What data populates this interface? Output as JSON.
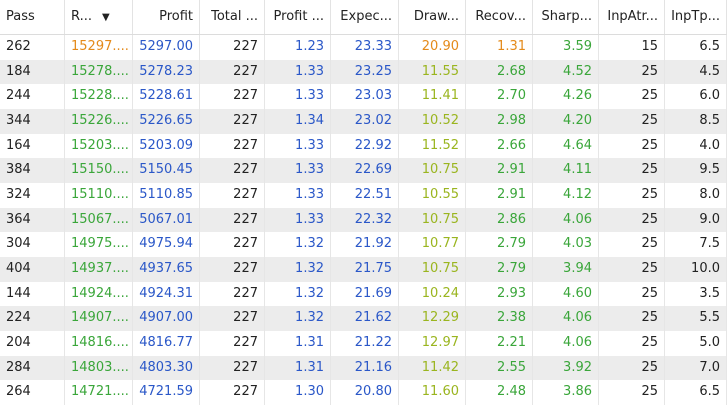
{
  "columns": [
    {
      "label": "Pass"
    },
    {
      "label": "R...",
      "sort_icon": "sort-desc-icon",
      "sort_glyph": "▼"
    },
    {
      "label": "Profit"
    },
    {
      "label": "Total ..."
    },
    {
      "label": "Profit ..."
    },
    {
      "label": "Expec..."
    },
    {
      "label": "Draw..."
    },
    {
      "label": "Recov..."
    },
    {
      "label": "Sharp..."
    },
    {
      "label": "InpAtr..."
    },
    {
      "label": "InpTp..."
    }
  ],
  "colors": {
    "black": "#222222",
    "green": "#3aa63a",
    "blue": "#2a57c8",
    "orange": "#e48a1a",
    "olive": "#9ab51f",
    "alt_row": "#ececec"
  },
  "rows": [
    {
      "pass": "262",
      "result": "15297....",
      "profit": "5297.00",
      "total": "227",
      "pf": "1.23",
      "exp": "23.33",
      "dd": "20.90",
      "rec": "1.31",
      "sharpe": "3.59",
      "atr": "15",
      "tp": "6.5",
      "style": "orange"
    },
    {
      "pass": "184",
      "result": "15278....",
      "profit": "5278.23",
      "total": "227",
      "pf": "1.33",
      "exp": "23.25",
      "dd": "11.55",
      "rec": "2.68",
      "sharpe": "4.52",
      "atr": "25",
      "tp": "4.5",
      "style": "green"
    },
    {
      "pass": "244",
      "result": "15228....",
      "profit": "5228.61",
      "total": "227",
      "pf": "1.33",
      "exp": "23.03",
      "dd": "11.41",
      "rec": "2.70",
      "sharpe": "4.26",
      "atr": "25",
      "tp": "6.0",
      "style": "green"
    },
    {
      "pass": "344",
      "result": "15226....",
      "profit": "5226.65",
      "total": "227",
      "pf": "1.34",
      "exp": "23.02",
      "dd": "10.52",
      "rec": "2.98",
      "sharpe": "4.20",
      "atr": "25",
      "tp": "8.5",
      "style": "green"
    },
    {
      "pass": "164",
      "result": "15203....",
      "profit": "5203.09",
      "total": "227",
      "pf": "1.33",
      "exp": "22.92",
      "dd": "11.52",
      "rec": "2.66",
      "sharpe": "4.64",
      "atr": "25",
      "tp": "4.0",
      "style": "green"
    },
    {
      "pass": "384",
      "result": "15150....",
      "profit": "5150.45",
      "total": "227",
      "pf": "1.33",
      "exp": "22.69",
      "dd": "10.75",
      "rec": "2.91",
      "sharpe": "4.11",
      "atr": "25",
      "tp": "9.5",
      "style": "green"
    },
    {
      "pass": "324",
      "result": "15110....",
      "profit": "5110.85",
      "total": "227",
      "pf": "1.33",
      "exp": "22.51",
      "dd": "10.55",
      "rec": "2.91",
      "sharpe": "4.12",
      "atr": "25",
      "tp": "8.0",
      "style": "green"
    },
    {
      "pass": "364",
      "result": "15067....",
      "profit": "5067.01",
      "total": "227",
      "pf": "1.33",
      "exp": "22.32",
      "dd": "10.75",
      "rec": "2.86",
      "sharpe": "4.06",
      "atr": "25",
      "tp": "9.0",
      "style": "green"
    },
    {
      "pass": "304",
      "result": "14975....",
      "profit": "4975.94",
      "total": "227",
      "pf": "1.32",
      "exp": "21.92",
      "dd": "10.77",
      "rec": "2.79",
      "sharpe": "4.03",
      "atr": "25",
      "tp": "7.5",
      "style": "green"
    },
    {
      "pass": "404",
      "result": "14937....",
      "profit": "4937.65",
      "total": "227",
      "pf": "1.32",
      "exp": "21.75",
      "dd": "10.75",
      "rec": "2.79",
      "sharpe": "3.94",
      "atr": "25",
      "tp": "10.0",
      "style": "green"
    },
    {
      "pass": "144",
      "result": "14924....",
      "profit": "4924.31",
      "total": "227",
      "pf": "1.32",
      "exp": "21.69",
      "dd": "10.24",
      "rec": "2.93",
      "sharpe": "4.60",
      "atr": "25",
      "tp": "3.5",
      "style": "green"
    },
    {
      "pass": "224",
      "result": "14907....",
      "profit": "4907.00",
      "total": "227",
      "pf": "1.32",
      "exp": "21.62",
      "dd": "12.29",
      "rec": "2.38",
      "sharpe": "4.06",
      "atr": "25",
      "tp": "5.5",
      "style": "green"
    },
    {
      "pass": "204",
      "result": "14816....",
      "profit": "4816.77",
      "total": "227",
      "pf": "1.31",
      "exp": "21.22",
      "dd": "12.97",
      "rec": "2.21",
      "sharpe": "4.06",
      "atr": "25",
      "tp": "5.0",
      "style": "green"
    },
    {
      "pass": "284",
      "result": "14803....",
      "profit": "4803.30",
      "total": "227",
      "pf": "1.31",
      "exp": "21.16",
      "dd": "11.42",
      "rec": "2.55",
      "sharpe": "3.92",
      "atr": "25",
      "tp": "7.0",
      "style": "green"
    },
    {
      "pass": "264",
      "result": "14721....",
      "profit": "4721.59",
      "total": "227",
      "pf": "1.30",
      "exp": "20.80",
      "dd": "11.60",
      "rec": "2.48",
      "sharpe": "3.86",
      "atr": "25",
      "tp": "6.5",
      "style": "green"
    }
  ]
}
